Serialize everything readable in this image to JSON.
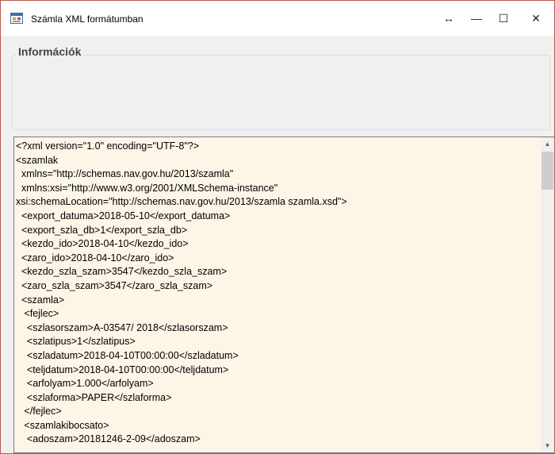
{
  "window": {
    "title": "Számla XML formátumban",
    "icon": "app-form-icon",
    "controls": {
      "resize": "↔",
      "minimize": "—",
      "maximize": "☐",
      "close": "✕"
    }
  },
  "info_group": {
    "title": "Információk"
  },
  "xml": {
    "lines": [
      "<?xml version=\"1.0\" encoding=\"UTF-8\"?>",
      "<szamlak",
      "  xmlns=\"http://schemas.nav.gov.hu/2013/szamla\"",
      "  xmlns:xsi=\"http://www.w3.org/2001/XMLSchema-instance\"",
      "xsi:schemaLocation=\"http://schemas.nav.gov.hu/2013/szamla szamla.xsd\">",
      "  <export_datuma>2018-05-10</export_datuma>",
      "  <export_szla_db>1</export_szla_db>",
      "  <kezdo_ido>2018-04-10</kezdo_ido>",
      "  <zaro_ido>2018-04-10</zaro_ido>",
      "  <kezdo_szla_szam>3547</kezdo_szla_szam>",
      "  <zaro_szla_szam>3547</zaro_szla_szam>",
      "  <szamla>",
      "   <fejlec>",
      "    <szlasorszam>A-03547/ 2018</szlasorszam>",
      "    <szlatipus>1</szlatipus>",
      "    <szladatum>2018-04-10T00:00:00</szladatum>",
      "    <teljdatum>2018-04-10T00:00:00</teljdatum>",
      "    <arfolyam>1.000</arfolyam>",
      "    <szlaforma>PAPER</szlaforma>",
      "   </fejlec>",
      "   <szamlakibocsato>",
      "    <adoszam>20181246-2-09</adoszam>"
    ]
  }
}
